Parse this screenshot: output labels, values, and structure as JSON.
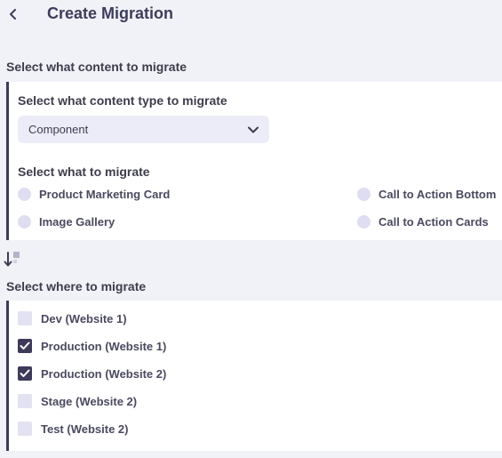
{
  "header": {
    "title": "Create Migration",
    "back_icon": "chevron-left-icon"
  },
  "content_section": {
    "title": "Select what content to migrate",
    "content_type_label": "Select what content type to migrate",
    "content_type_value": "Component",
    "what_label": "Select what to migrate",
    "options": [
      {
        "label": "Product Marketing Card",
        "selected": false
      },
      {
        "label": "Call to Action Bottom",
        "selected": false
      },
      {
        "label": "Image Gallery",
        "selected": false
      },
      {
        "label": "Call to Action Cards",
        "selected": false
      }
    ]
  },
  "divider_icon": "migrate-arrow-icon",
  "target_section": {
    "title": "Select where to migrate",
    "targets": [
      {
        "label": "Dev (Website 1)",
        "checked": false
      },
      {
        "label": "Production (Website 1)",
        "checked": true
      },
      {
        "label": "Production (Website 2)",
        "checked": true
      },
      {
        "label": "Stage (Website 2)",
        "checked": false
      },
      {
        "label": "Test (Website 2)",
        "checked": false
      }
    ]
  },
  "colors": {
    "accent": "#3d3a5a",
    "background": "#f1f1f8",
    "panel": "#ffffff",
    "control_bg": "#ececf8"
  }
}
